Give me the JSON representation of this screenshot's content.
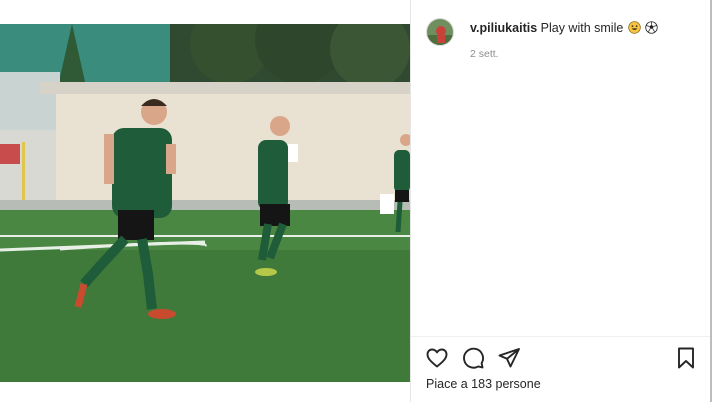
{
  "post": {
    "username": "v.piliukaitis",
    "caption": "Play with smile",
    "caption_emojis": [
      "grinning-face-emoji",
      "soccer-ball-emoji"
    ],
    "timestamp": "2 sett.",
    "likes_text": "Piace a 183 persone"
  },
  "icons": {
    "like": "heart-icon",
    "comment": "comment-icon",
    "share": "paper-plane-icon",
    "save": "bookmark-icon"
  },
  "colors": {
    "text": "#262626",
    "muted": "#8e8e8e",
    "pitch": "#3f7a3a",
    "jersey": "#1e5c3a"
  }
}
